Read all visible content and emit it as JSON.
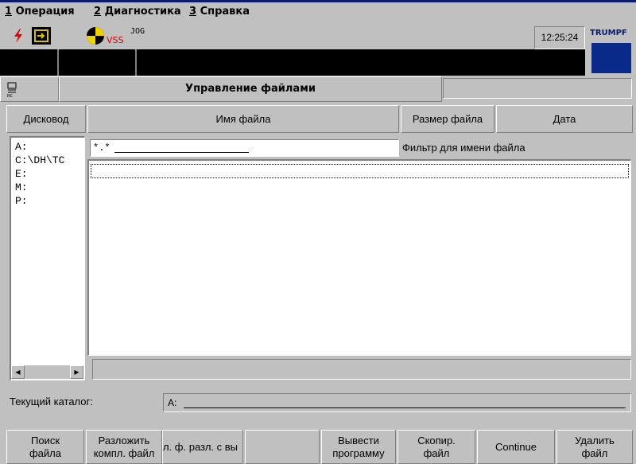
{
  "menu": {
    "items": [
      {
        "num": "1",
        "label": " Операция"
      },
      {
        "num": "2",
        "label": " Диагностика"
      },
      {
        "num": "3",
        "label": " Справка"
      }
    ]
  },
  "status": {
    "vss": "VSS",
    "mode": "JOG",
    "clock": "12:25:24",
    "logo": "TRUMPF"
  },
  "title": {
    "text": "Управление файлами",
    "icon": "nc-program-icon"
  },
  "headers": {
    "drive": "Дисковод",
    "filename": "Имя файла",
    "filesize": "Размер файла",
    "date": "Дата"
  },
  "drives": [
    "A:",
    "C:\\DH\\TC",
    "E:",
    "M:",
    "P:"
  ],
  "filter": {
    "value": "*.*",
    "label": "Фильтр для имени файла"
  },
  "current_dir": {
    "label": "Текущий каталог:",
    "value": "A:"
  },
  "softkeys": [
    {
      "line1": "Поиск",
      "line2": "файла"
    },
    {
      "line1": "Разложить",
      "line2": "компл. файл"
    },
    {
      "line1": "л. ф. разл. с вы",
      "line2": ""
    },
    {
      "line1": "",
      "line2": ""
    },
    {
      "line1": "Вывести",
      "line2": "программу"
    },
    {
      "line1": "Скопир.",
      "line2": "файл"
    },
    {
      "line1": "Continue",
      "line2": ""
    },
    {
      "line1": "Удалить",
      "line2": "файл"
    }
  ],
  "colors": {
    "background": "#c0c0c0",
    "accent": "#0a2a8a",
    "alarm": "#e00000"
  }
}
